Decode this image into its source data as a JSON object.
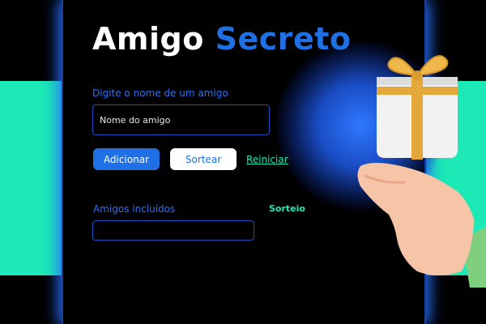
{
  "header": {
    "title_part1": "Amigo",
    "title_part2": "Secreto"
  },
  "form": {
    "input_label": "Digite o nome de um amigo",
    "input_placeholder": "Nome do amigo",
    "input_value": "",
    "add_button": "Adicionar",
    "draw_button": "Sortear",
    "reset_link": "Reiniciar"
  },
  "lists": {
    "friends_label": "Amigos incluídos",
    "friends": [],
    "result_label": "Sorteio"
  },
  "colors": {
    "accent_blue": "#1f6fe5",
    "accent_teal": "#1de9b6",
    "background": "#000000"
  },
  "illustration": {
    "icon": "gift-on-hand-icon"
  }
}
